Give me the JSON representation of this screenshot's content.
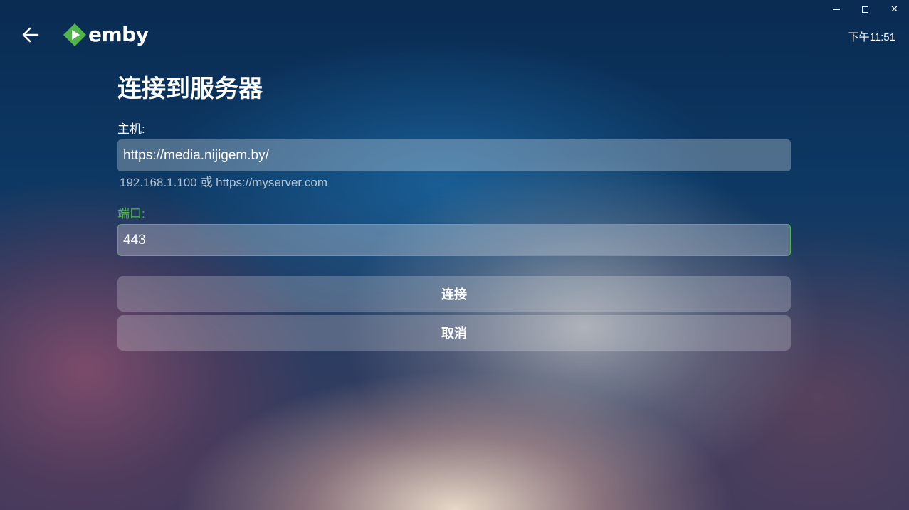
{
  "window": {
    "min_icon": "minimize-icon",
    "max_icon": "maximize-icon",
    "close_icon": "close-icon",
    "close_glyph": "✕"
  },
  "header": {
    "back_icon": "arrow-left-icon",
    "logo_text": "emby",
    "brand_color": "#52b54b",
    "clock": "下午11:51"
  },
  "form": {
    "title": "连接到服务器",
    "host": {
      "label": "主机:",
      "value": "https://media.nijigem.by/",
      "hint": "192.168.1.100 或 https://myserver.com"
    },
    "port": {
      "label": "端口:",
      "value": "443"
    },
    "connect_label": "连接",
    "cancel_label": "取消"
  }
}
